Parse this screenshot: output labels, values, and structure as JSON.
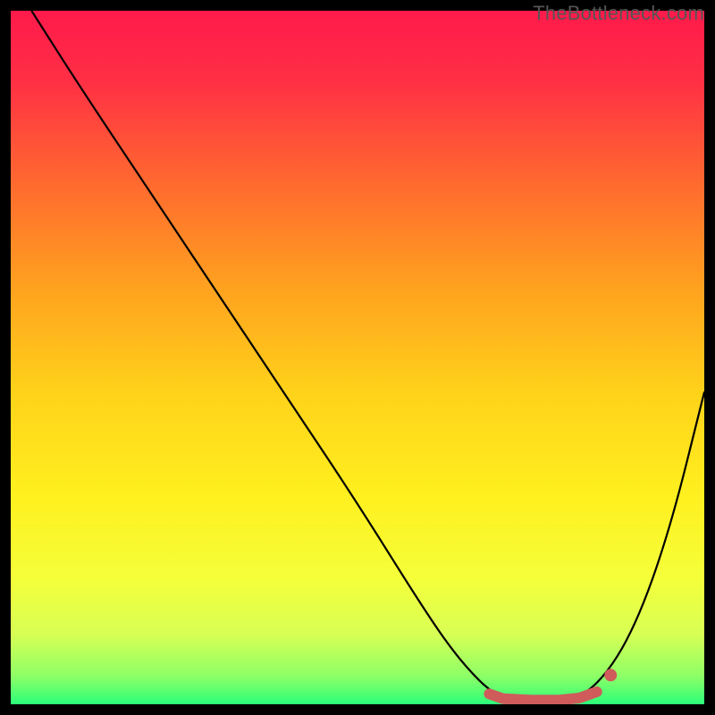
{
  "watermark": "TheBottleneck.com",
  "chart_data": {
    "type": "line",
    "title": "",
    "xlabel": "",
    "ylabel": "",
    "xlim": [
      0,
      100
    ],
    "ylim": [
      0,
      100
    ],
    "gradient_stops": [
      {
        "offset": 0.0,
        "color": "#ff1a4b"
      },
      {
        "offset": 0.1,
        "color": "#ff2f45"
      },
      {
        "offset": 0.25,
        "color": "#ff6a2f"
      },
      {
        "offset": 0.4,
        "color": "#ffa21f"
      },
      {
        "offset": 0.55,
        "color": "#ffd21a"
      },
      {
        "offset": 0.7,
        "color": "#fff01f"
      },
      {
        "offset": 0.82,
        "color": "#f4ff3a"
      },
      {
        "offset": 0.9,
        "color": "#d7ff55"
      },
      {
        "offset": 0.96,
        "color": "#8cff66"
      },
      {
        "offset": 1.0,
        "color": "#2bff7a"
      }
    ],
    "series": [
      {
        "name": "bottleneck-curve",
        "x": [
          3,
          10,
          20,
          30,
          40,
          50,
          60,
          65,
          70,
          75,
          80,
          85,
          90,
          95,
          100
        ],
        "y": [
          100,
          89,
          74,
          59,
          44,
          29,
          13,
          6,
          1,
          0,
          0,
          3,
          11,
          25,
          45
        ]
      }
    ],
    "markers": [
      {
        "name": "flat-segment",
        "kind": "thick-line",
        "color": "#cf5b5b",
        "points": [
          {
            "x": 69,
            "y": 1.5
          },
          {
            "x": 71,
            "y": 0.8
          },
          {
            "x": 75,
            "y": 0.6
          },
          {
            "x": 79,
            "y": 0.6
          },
          {
            "x": 82,
            "y": 0.9
          },
          {
            "x": 84.5,
            "y": 1.8
          }
        ],
        "width": 12
      },
      {
        "name": "right-dot",
        "kind": "dot",
        "color": "#cf5b5b",
        "x": 86.5,
        "y": 4.2,
        "r": 7
      }
    ]
  }
}
